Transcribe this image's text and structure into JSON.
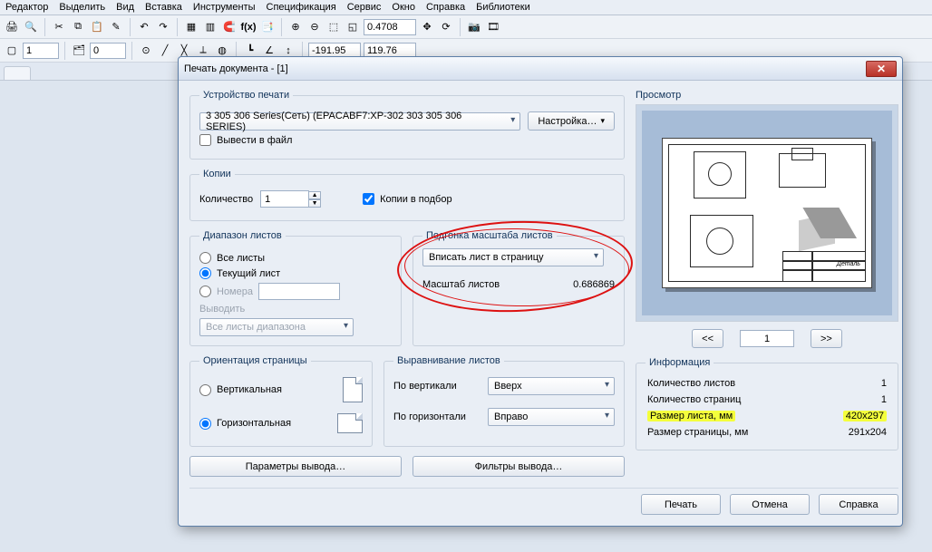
{
  "menu": {
    "editor": "Редактор",
    "select": "Выделить",
    "view": "Вид",
    "insert": "Вставка",
    "tools": "Инструменты",
    "spec": "Спецификация",
    "service": "Сервис",
    "window": "Окно",
    "help": "Справка",
    "libs": "Библиотеки"
  },
  "toolbar": {
    "zoom_value": "0.4708",
    "layer_value": "1",
    "color_value": "0",
    "coord_x": "-191.95",
    "coord_y": "119.76"
  },
  "dialog": {
    "title": "Печать документа - [1]",
    "device_group": "Устройство печати",
    "device_value": "3 305 306 Series(Сеть) (EPACABF7:XP-302 303 305 306 SERIES)",
    "settings_btn": "Настройка…",
    "to_file": "Вывести в файл",
    "copies_group": "Копии",
    "qty_label": "Количество",
    "qty_value": "1",
    "collate": "Копии в подбор",
    "range_group": "Диапазон листов",
    "all_sheets": "Все листы",
    "current": "Текущий лист",
    "numbers": "Номера",
    "output_label": "Выводить",
    "output_value": "Все листы диапазона",
    "fit_group": "Подгонка масштаба листов",
    "fit_value": "Вписать лист в страницу",
    "scale_label": "Масштаб листов",
    "scale_value": "0.686869",
    "orient_group": "Ориентация страницы",
    "vert": "Вертикальная",
    "horiz": "Горизонтальная",
    "align_group": "Выравнивание листов",
    "vlabel": "По вертикали",
    "vval": "Вверх",
    "hlabel": "По горизонтали",
    "hval": "Вправо",
    "params_btn": "Параметры вывода…",
    "filters_btn": "Фильтры вывода…",
    "preview_label": "Просмотр",
    "page_num": "1",
    "info_label": "Информация",
    "info": {
      "sheets_label": "Количество листов",
      "sheets_val": "1",
      "pages_label": "Количество страниц",
      "pages_val": "1",
      "size_label": "Размер листа, мм",
      "size_val": "420x297",
      "psize_label": "Размер страницы, мм",
      "psize_val": "291x204"
    },
    "print": "Печать",
    "cancel": "Отмена",
    "help": "Справка",
    "prev": "<<",
    "next": ">>"
  }
}
